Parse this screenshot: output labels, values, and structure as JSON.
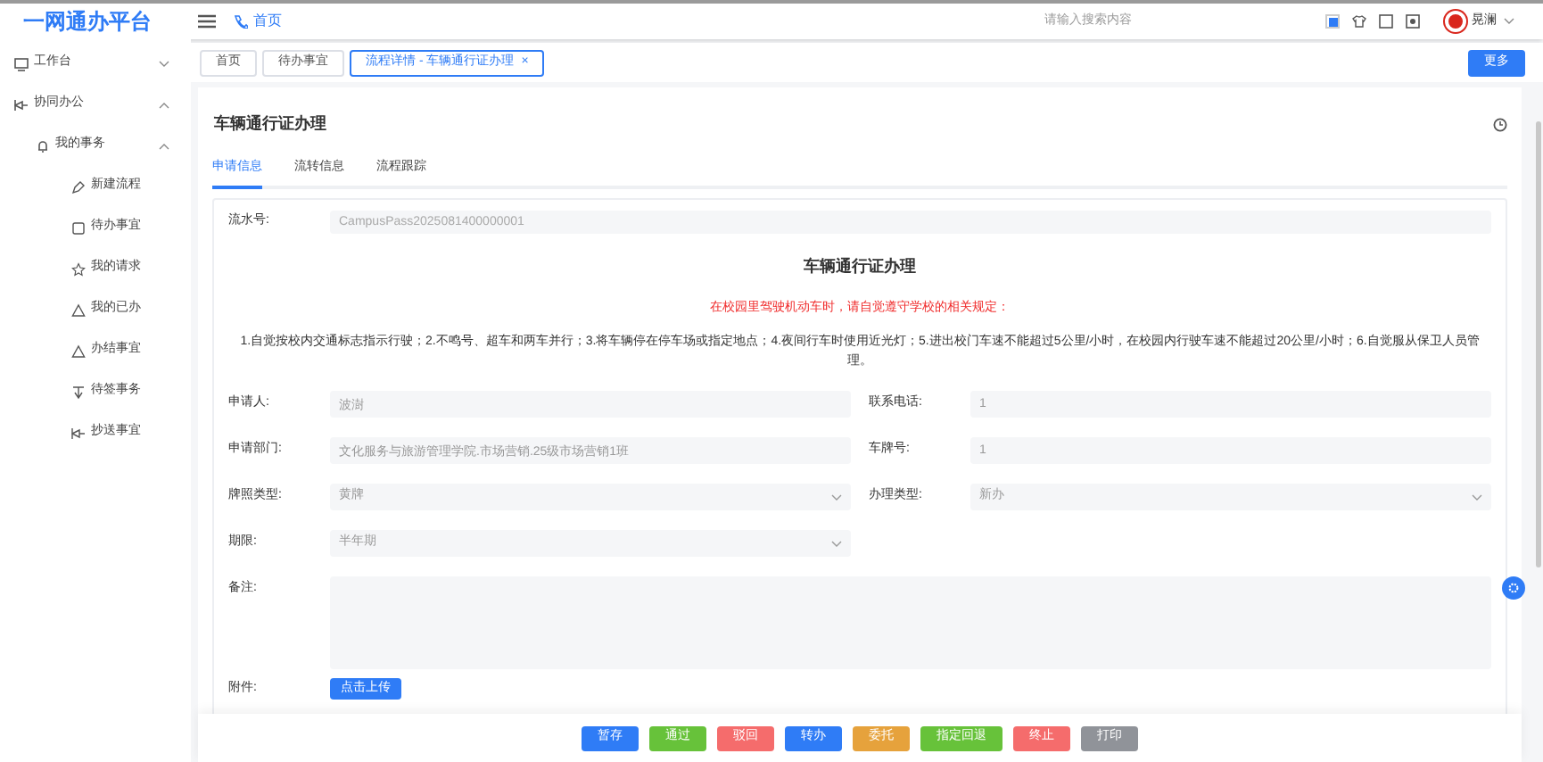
{
  "header": {
    "logo": "一网通办平台",
    "breadcrumb": "首页",
    "search": {
      "placeholder": "请输入搜索内容"
    },
    "user": "晃澜"
  },
  "sidebar": {
    "items": [
      {
        "label": "工作台",
        "expanded": false
      },
      {
        "label": "协同办公",
        "expanded": true,
        "children": [
          {
            "label": "我的事务",
            "expanded": true,
            "children": [
              {
                "label": "新建流程"
              },
              {
                "label": "待办事宜"
              },
              {
                "label": "我的请求"
              },
              {
                "label": "我的已办"
              },
              {
                "label": "办结事宜"
              },
              {
                "label": "待签事务"
              },
              {
                "label": "抄送事宜"
              }
            ]
          }
        ]
      }
    ]
  },
  "page_tabs": [
    {
      "label": "首页",
      "selected": false
    },
    {
      "label": "待办事宜",
      "selected": false
    },
    {
      "label": "流程详情 - 车辆通行证办理",
      "selected": true,
      "close": "×"
    }
  ],
  "more_button": "更多",
  "card": {
    "title": "车辆通行证办理",
    "tabs": [
      {
        "label": "申请信息",
        "selected": true
      },
      {
        "label": "流转信息",
        "selected": false
      },
      {
        "label": "流程跟踪",
        "selected": false
      }
    ],
    "serial": {
      "label": "流水号:",
      "value": "CampusPass2025081400000001"
    },
    "form_title": "车辆通行证办理",
    "notice": "在校园里驾驶机动车时，请自觉遵守学校的相关规定：",
    "rules": "1.自觉按校内交通标志指示行驶；2.不鸣号、超车和两车并行；3.将车辆停在停车场或指定地点；4.夜间行车时使用近光灯；5.进出校门车速不能超过5公里/小时，在校园内行驶车速不能超过20公里/小时；6.自觉服从保卫人员管理。",
    "fields": [
      {
        "label": "申请人:",
        "value": "波澍",
        "kind": "input"
      },
      {
        "label": "联系电话:",
        "value": "1",
        "kind": "input"
      },
      {
        "label": "申请部门:",
        "value": "文化服务与旅游管理学院.市场营销.25级市场营销1班",
        "kind": "input"
      },
      {
        "label": "车牌号:",
        "value": "1",
        "kind": "input"
      },
      {
        "label": "牌照类型:",
        "value": "黄牌",
        "kind": "select"
      },
      {
        "label": "办理类型:",
        "value": "新办",
        "kind": "select"
      },
      {
        "label": "期限:",
        "value": "半年期",
        "kind": "select"
      }
    ],
    "remark": {
      "label": "备注:"
    },
    "attachment": {
      "label": "附件:",
      "button": "点击上传"
    }
  },
  "actions": [
    {
      "label": "暂存",
      "color": "#2f7cf6"
    },
    {
      "label": "通过",
      "color": "#67c23a"
    },
    {
      "label": "驳回",
      "color": "#f56c6c"
    },
    {
      "label": "转办",
      "color": "#2f7cf6"
    },
    {
      "label": "委托",
      "color": "#e6a23c"
    },
    {
      "label": "指定回退",
      "color": "#67c23a"
    },
    {
      "label": "终止",
      "color": "#f56c6c"
    },
    {
      "label": "打印",
      "color": "#909399"
    }
  ]
}
